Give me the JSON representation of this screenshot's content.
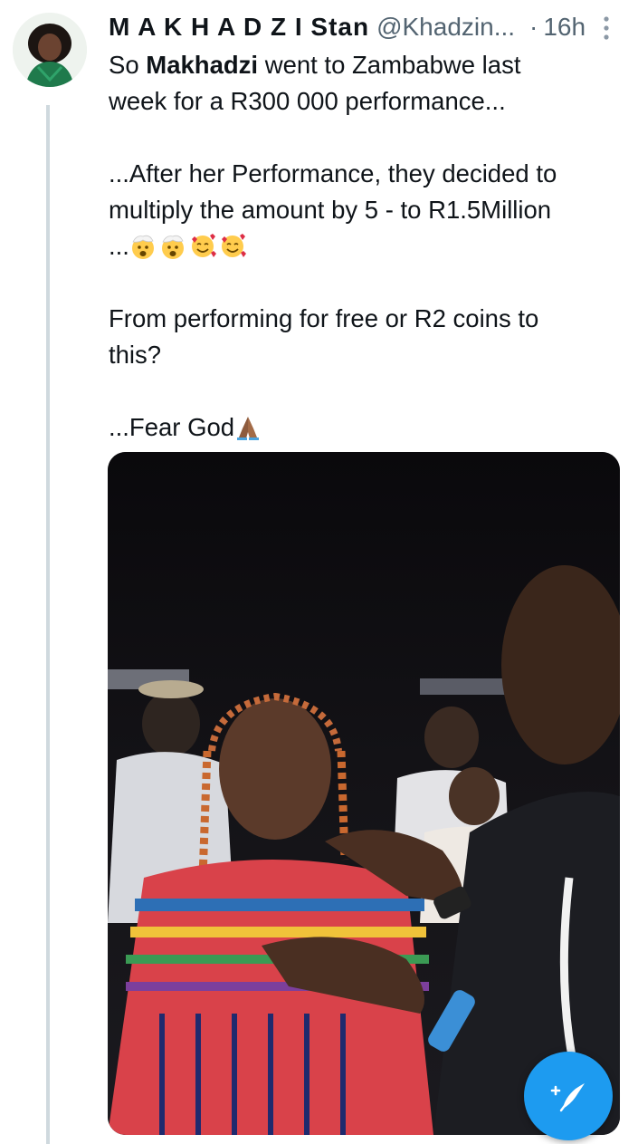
{
  "tweet": {
    "display_name": "M A K H A D Z I Stan",
    "handle": "@Khadzin...",
    "separator": "·",
    "timestamp": "16h",
    "body": {
      "p1_prefix": "So ",
      "p1_bold": "Makhadzi",
      "p1_rest": " went to Zambabwe last",
      "p1_line2": "week for a R300 000 performance...",
      "p2_line1": "...After her Performance, they decided to",
      "p2_line2": "multiply the amount by 5 - to R1.5Million",
      "p2_line3_prefix": "...",
      "p3_line1": "From performing for free or R2 coins to",
      "p3_line2": "this?",
      "p4": "...Fear God"
    },
    "emojis": [
      "exploding-head-emoji",
      "exploding-head-emoji",
      "smiling-face-with-hearts-emoji",
      "smiling-face-with-hearts-emoji",
      "folded-hands-emoji"
    ],
    "media_description_icon": "photo"
  },
  "fab": {
    "icon": "compose-tweet-icon"
  },
  "colors": {
    "accent": "#1d9bf0",
    "secondary_text": "#536471",
    "thread_line": "#cfd9de"
  }
}
